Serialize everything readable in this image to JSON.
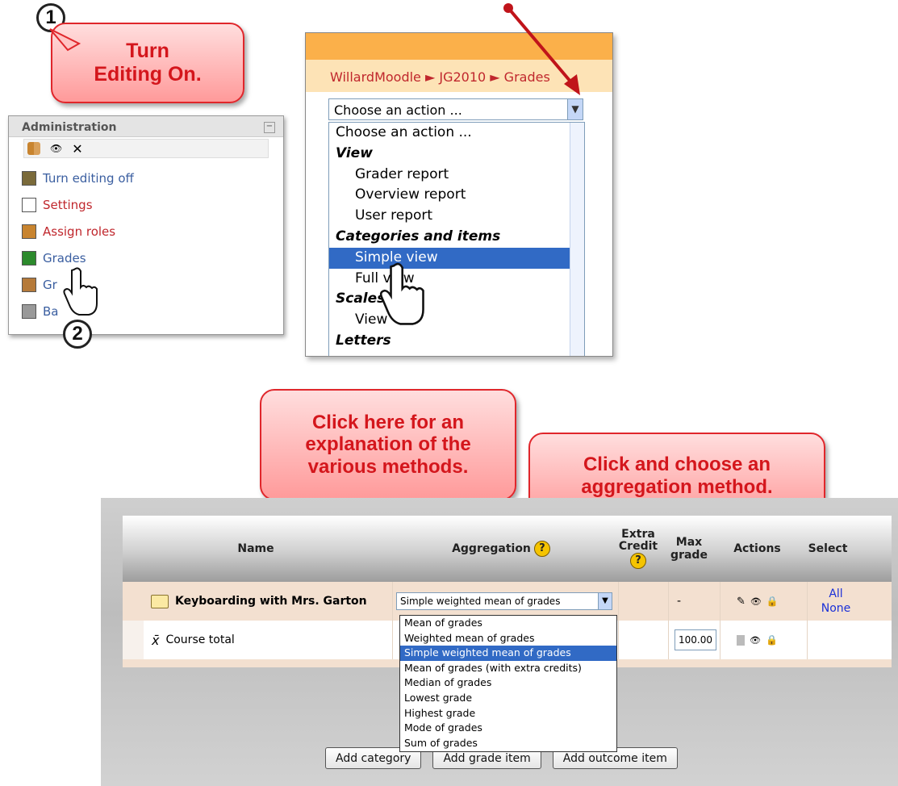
{
  "step1": {
    "number": "1",
    "text_line1": "Turn",
    "text_line2": "Editing On."
  },
  "step2": {
    "number": "2"
  },
  "admin": {
    "title": "Administration",
    "minimize": "−",
    "items": [
      {
        "label": "Turn editing off",
        "icon": "edit-pencil-icon",
        "color": "#3a5ea0"
      },
      {
        "label": "Settings",
        "icon": "settings-page-icon",
        "color": "#c0272d"
      },
      {
        "label": "Assign roles",
        "icon": "assign-roles-icon",
        "color": "#c0272d"
      },
      {
        "label": "Grades",
        "icon": "grades-grid-icon",
        "color": "#3a5ea0"
      },
      {
        "label": "Gr",
        "icon": "groups-icon",
        "color": "#3a5ea0"
      },
      {
        "label": "Ba",
        "icon": "backup-icon",
        "color": "#3a5ea0"
      }
    ]
  },
  "dropdown_shot": {
    "breadcrumb": "WillardMoodle ► JG2010 ► Grades",
    "select_value": "Choose an action ...",
    "options": [
      {
        "label": "Choose an action ...",
        "kind": "opt"
      },
      {
        "label": "View",
        "kind": "group"
      },
      {
        "label": "Grader report",
        "kind": "sub"
      },
      {
        "label": "Overview report",
        "kind": "sub"
      },
      {
        "label": "User report",
        "kind": "sub"
      },
      {
        "label": "Categories and items",
        "kind": "group"
      },
      {
        "label": "Simple view",
        "kind": "sub",
        "selected": true
      },
      {
        "label": "Full view",
        "kind": "sub"
      },
      {
        "label": "Scales",
        "kind": "group"
      },
      {
        "label": "View",
        "kind": "sub"
      },
      {
        "label": "Letters",
        "kind": "group"
      }
    ]
  },
  "callouts": {
    "explain": "Click here for an explanation of the various methods.",
    "choose": "Click and choose an aggregation method."
  },
  "grades": {
    "headers": {
      "name": "Name",
      "aggregation": "Aggregation",
      "extra_credit": "Extra Credit",
      "max_grade": "Max grade",
      "actions": "Actions",
      "select": "Select"
    },
    "category": {
      "name": "Keyboarding with Mrs. Garton",
      "aggregation": "Simple weighted mean of grades",
      "max_grade": "-",
      "select_all": "All",
      "select_none": "None"
    },
    "total": {
      "symbol": "x̄",
      "name": "Course total",
      "max_grade": "100.00"
    },
    "aggregation_options": [
      "Mean of grades",
      "Weighted mean of grades",
      "Simple weighted mean of grades",
      "Mean of grades (with extra credits)",
      "Median of grades",
      "Lowest grade",
      "Highest grade",
      "Mode of grades",
      "Sum of grades"
    ],
    "selected_option": "Simple weighted mean of grades",
    "buttons": {
      "add_category": "Add category",
      "add_grade_item": "Add grade item",
      "add_outcome_item": "Add outcome item"
    },
    "help_symbol": "?"
  },
  "colors": {
    "callout_text": "#d4161c",
    "callout_border": "#e0262b",
    "highlight": "#316ac5",
    "arrow": "#c0141a"
  }
}
